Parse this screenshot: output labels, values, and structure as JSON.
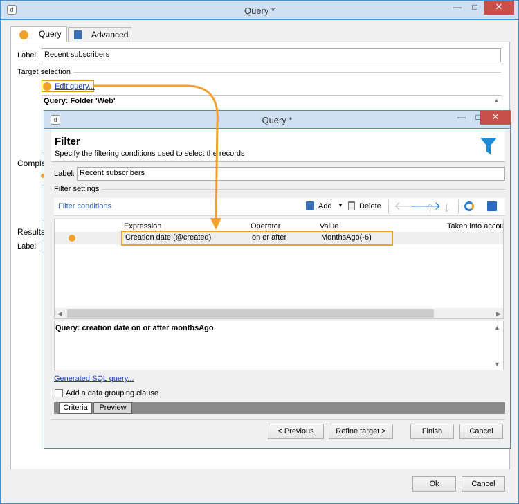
{
  "outer": {
    "title": "Query *",
    "tabs": [
      {
        "label": "Query"
      },
      {
        "label": "Advanced"
      }
    ],
    "label_caption": "Label:",
    "label_value": "Recent subscribers",
    "target_selection": "Target selection",
    "edit_query_link": "Edit query...",
    "query_text": "Query: Folder 'Web'",
    "complete_partial": "Comple",
    "results_partial": "Results",
    "label2_partial": "Label:",
    "ok_label": "Ok",
    "cancel_label": "Cancel"
  },
  "filter": {
    "title": "Query *",
    "heading": "Filter",
    "subheading": "Specify the filtering conditions used to select the records",
    "label_caption": "Label:",
    "label_value": "Recent subscribers",
    "filter_settings": "Filter settings",
    "filter_conditions": "Filter conditions",
    "add_label": "Add",
    "delete_label": "Delete",
    "columns": [
      "Expression",
      "Operator",
      "Value",
      "Taken into accou"
    ],
    "rows": [
      {
        "expression": "Creation date (@created)",
        "operator": "on or after",
        "value": "MonthsAgo(-6)"
      }
    ],
    "query_summary": "Query: creation date on or after monthsAgo",
    "generated_sql_link": "Generated SQL query...",
    "grouping_checkbox_label": "Add a data grouping clause",
    "bottom_tabs": [
      {
        "label": "Criteria"
      },
      {
        "label": "Preview"
      }
    ],
    "previous_label": "< Previous",
    "refine_label": "Refine target >",
    "finish_label": "Finish",
    "cancel_label": "Cancel"
  },
  "colors": {
    "accent_orange": "#f1a22a",
    "title_blue": "#3b92d8",
    "link_blue": "#1a3eb5",
    "close_red": "#c7504b",
    "funnel_blue": "#1e8bd6"
  }
}
